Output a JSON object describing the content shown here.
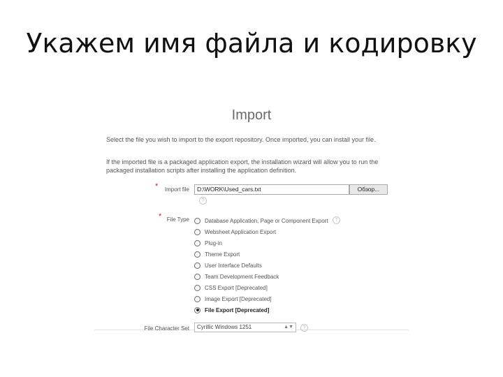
{
  "slide": {
    "title": "Укажем имя файла и кодировку"
  },
  "dialog": {
    "title": "Import",
    "description_1": "Select the file you wish to import to the export repository. Once imported, you can install your file.",
    "description_2": "If the imported file is a packaged application export, the installation wizard will allow you to run the packaged installation scripts after installing the application definition.",
    "required_marker": "*",
    "import_file": {
      "label": "Import file",
      "value": "D:\\WORK\\Used_cars.txt",
      "browse_label": "Обзор..."
    },
    "file_type": {
      "label": "File Type",
      "options": [
        {
          "label": "Database Application, Page or Component Export",
          "selected": false
        },
        {
          "label": "Websheet Application Export",
          "selected": false
        },
        {
          "label": "Plug-in",
          "selected": false
        },
        {
          "label": "Theme Export",
          "selected": false
        },
        {
          "label": "User Interface Defaults",
          "selected": false
        },
        {
          "label": "Team Development Feedback",
          "selected": false
        },
        {
          "label": "CSS Export [Deprecated]",
          "selected": false
        },
        {
          "label": "Image Export [Deprecated]",
          "selected": false
        },
        {
          "label": "File Export [Deprecated]",
          "selected": true
        }
      ]
    },
    "charset": {
      "label": "File Character Set",
      "value": "Cyrillic Windows 1251"
    },
    "help_glyph": "?",
    "caret_glyph": "▲▼"
  }
}
